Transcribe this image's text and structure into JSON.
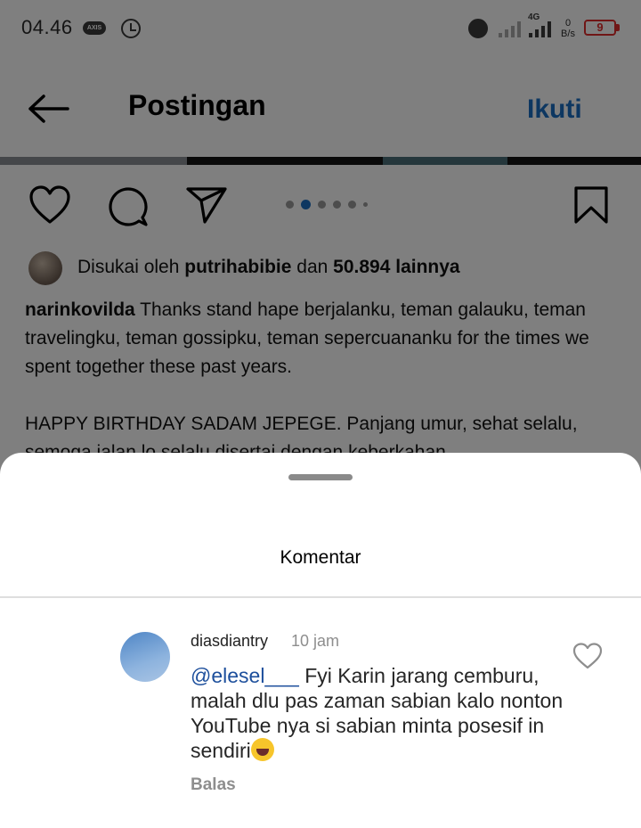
{
  "status_bar": {
    "time": "04.46",
    "carrier": "AXIS",
    "network": "4G",
    "speed_value": "0",
    "speed_unit": "B/s",
    "battery": "9",
    "battery_color": "#e02d2d"
  },
  "header": {
    "title": "Postingan",
    "follow_label": "Ikuti",
    "accent_color": "#1b6fc2"
  },
  "post": {
    "carousel": {
      "count": 6,
      "active_index": 1
    },
    "likes": {
      "prefix": "Disukai oleh",
      "user": "putrihabibie",
      "connector": "dan",
      "count": "50.894",
      "suffix": "lainnya"
    },
    "caption": {
      "author": "narinkovilda",
      "line1": " Thanks stand hape berjalanku, teman galauku, teman travelingku, teman gossipku, teman sepercuananku for the times we spent together these past years.",
      "line2": "HAPPY BIRTHDAY SADAM JEPEGE. Panjang umur, sehat selalu, semoga jalan lo selalu disertai dengan keberkahan."
    }
  },
  "comments_sheet": {
    "title": "Komentar",
    "comment": {
      "username": "diasdiantry",
      "time": "10 jam",
      "mention": "@elesel___",
      "text": " Fyi Karin jarang cemburu, malah dlu pas zaman sabian kalo nonton YouTube nya si sabian minta posesif in sendiri",
      "emoji": "face-with-tears-of-joy",
      "reply_label": "Balas"
    }
  }
}
